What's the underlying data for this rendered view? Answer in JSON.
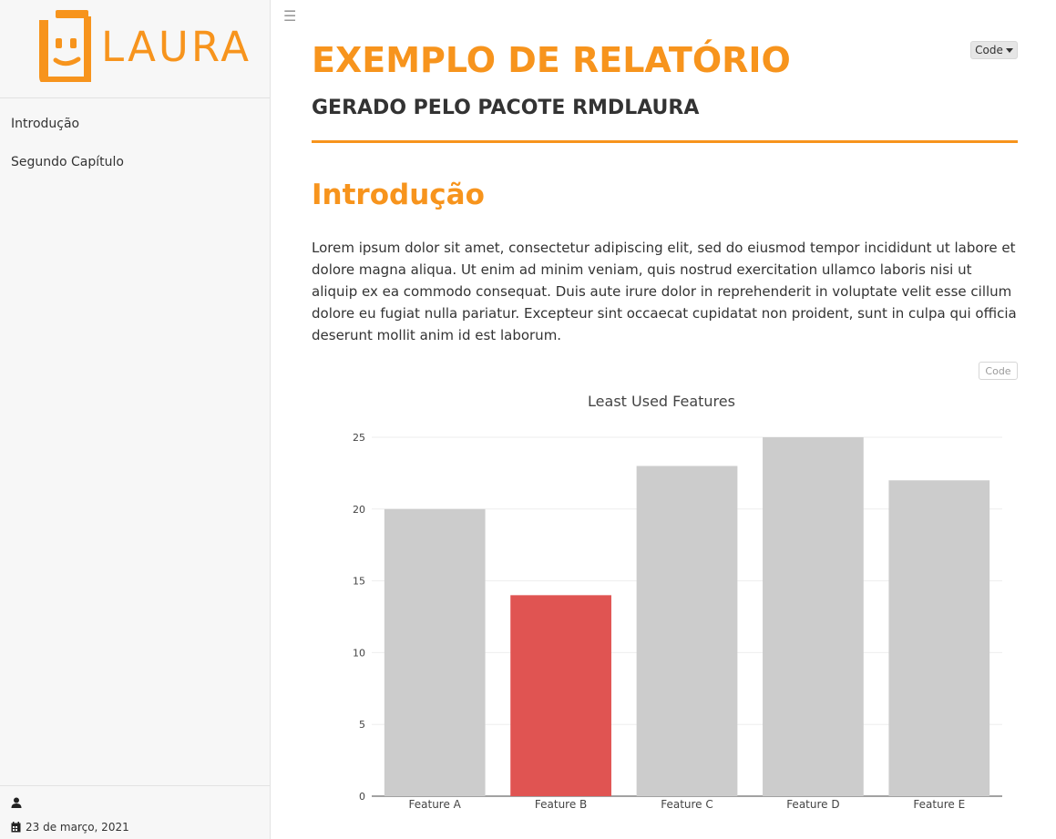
{
  "sidebar": {
    "logo_text": "LAURA",
    "nav": [
      {
        "label": "Introdução"
      },
      {
        "label": "Segundo Capítulo"
      }
    ],
    "footer": {
      "date": "23 de março, 2021"
    }
  },
  "colors": {
    "accent": "#f7941d",
    "bar_default": "#cccccc",
    "bar_highlight": "#e05452"
  },
  "header": {
    "code_dropdown_label": "Code",
    "title": "EXEMPLO DE RELATÓRIO",
    "subtitle": "GERADO PELO PACOTE RMDLAURA"
  },
  "main": {
    "section_heading": "Introdução",
    "paragraph": "Lorem ipsum dolor sit amet, consectetur adipiscing elit, sed do eiusmod tempor incididunt ut labore et dolore magna aliqua. Ut enim ad minim veniam, quis nostrud exercitation ullamco laboris nisi ut aliquip ex ea commodo consequat. Duis aute irure dolor in reprehenderit in voluptate velit esse cillum dolore eu fugiat nulla pariatur. Excepteur sint occaecat cupidatat non proident, sunt in culpa qui officia deserunt mollit anim id est laborum.",
    "code_button_label": "Code"
  },
  "chart_data": {
    "type": "bar",
    "title": "Least Used Features",
    "categories": [
      "Feature A",
      "Feature B",
      "Feature C",
      "Feature D",
      "Feature E"
    ],
    "values": [
      20,
      14,
      23,
      25,
      22
    ],
    "highlight": "Feature B",
    "ylim": [
      0,
      25
    ],
    "yticks": [
      0,
      5,
      10,
      15,
      20,
      25
    ],
    "grid": true,
    "xlabel": "",
    "ylabel": ""
  }
}
